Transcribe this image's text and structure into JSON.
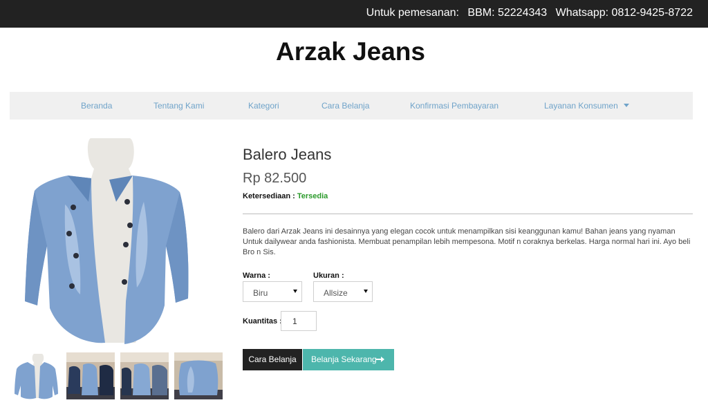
{
  "topbar": {
    "order_label": "Untuk pemesanan:",
    "bbm": "BBM: 52224343",
    "whatsapp": "Whatsapp: 0812-9425-8722"
  },
  "site": {
    "title": "Arzak Jeans"
  },
  "nav": {
    "items": [
      "Beranda",
      "Tentang Kami",
      "Kategori",
      "Cara Belanja",
      "Konfirmasi Pembayaran",
      "Layanan Konsumen"
    ]
  },
  "product": {
    "name": "Balero Jeans",
    "price": "Rp 82.500",
    "stock_label": "Ketersediaan :",
    "stock_value": "Tersedia",
    "description": "Balero dari Arzak Jeans ini desainnya yang elegan cocok untuk menampilkan sisi keanggunan kamu! Bahan jeans yang nyaman Untuk dailywear anda fashionista. Membuat penampilan lebih mempesona. Motif n coraknya berkelas. Harga normal hari ini. Ayo beli Bro n Sis.",
    "color_label": "Warna :",
    "color_value": "Biru",
    "size_label": "Ukuran :",
    "size_value": "Allsize",
    "qty_label": "Kuantitas :",
    "qty_value": "1"
  },
  "buttons": {
    "howto": "Cara Belanja",
    "buy": "Belanja Sekarang"
  },
  "icons": {
    "dropdown": "caret-down-icon",
    "buy": "arrow-right-icon"
  },
  "colors": {
    "topbar_bg": "#222222",
    "nav_link": "#6fa3c9",
    "stock_green": "#2a9a2a",
    "buy_button": "#4db6ac",
    "dark_button": "#222222"
  }
}
